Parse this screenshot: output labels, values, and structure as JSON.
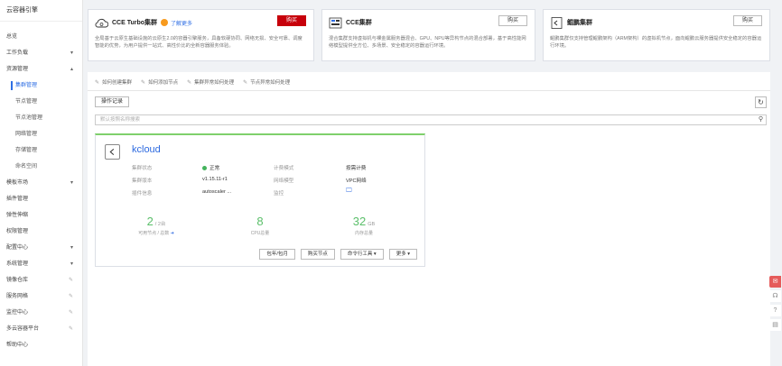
{
  "sidebar": {
    "brand": "云容器引擎",
    "items": [
      {
        "label": "总览",
        "sub": false
      },
      {
        "label": "工作负载",
        "sub": false,
        "caret": "▾"
      },
      {
        "label": "资源管理",
        "sub": false,
        "caret": "▴"
      },
      {
        "label": "集群管理",
        "sub": true,
        "active": true
      },
      {
        "label": "节点管理",
        "sub": true
      },
      {
        "label": "节点池管理",
        "sub": true
      },
      {
        "label": "网络管理",
        "sub": true
      },
      {
        "label": "存储管理",
        "sub": true
      },
      {
        "label": "命名空间",
        "sub": true
      },
      {
        "label": "模板市场",
        "sub": false,
        "caret": "▾"
      },
      {
        "label": "插件管理",
        "sub": false
      },
      {
        "label": "弹性伸缩",
        "sub": false
      },
      {
        "label": "权限管理",
        "sub": false
      },
      {
        "label": "配置中心",
        "sub": false,
        "caret": "▾"
      },
      {
        "label": "系统管理",
        "sub": false,
        "caret": "▾"
      },
      {
        "label": "镜像仓库",
        "sub": false,
        "pin": true
      },
      {
        "label": "服务网格",
        "sub": false,
        "pin": true
      },
      {
        "label": "监控中心",
        "sub": false,
        "pin": true
      },
      {
        "label": "多云容器平台",
        "sub": false,
        "pin": true
      },
      {
        "label": "帮助中心",
        "sub": false
      }
    ]
  },
  "cards": [
    {
      "title": "CCE Turbo集群",
      "link": "了解更多",
      "buy": "购买",
      "desc": "全局基于云原生基础设施的云原生2.0的容器引擎服务，具备软硬协同、网络无损、安全可靠、调度智能的优势，为用户提供一站式、高性价比的全新容器服务体验。"
    },
    {
      "title": "CCE集群",
      "buy": "购买",
      "desc": "混合集群支持虚拟机与裸金属服务器混合、GPU、NPU等异构节点的混合部署，基于高性能网络模型提供全方位、多场景、安全稳定的容器运行环境。"
    },
    {
      "title": "鲲鹏集群",
      "buy": "购买",
      "desc": "鲲鹏集群仅支持管理鲲鹏架构（ARM架构）的虚拟机节点，面向鲲鹏云服务器提供安全稳定的容器运行环境。"
    }
  ],
  "help_links": [
    "如何创建集群",
    "如何添加节点",
    "集群异常如何处理",
    "节点异常如何处理"
  ],
  "toolbar": {
    "ops_label": "操作记录",
    "refresh_icon": "refresh-icon"
  },
  "search": {
    "placeholder": "默认按照名称搜索",
    "value": ""
  },
  "cluster": {
    "name": "kcloud",
    "status_label": "集群状态",
    "status": "正常",
    "version_label": "集群版本",
    "version": "v1.15.11-r1",
    "plugins_label": "插件信息",
    "plugins": "autoscaler ...",
    "billing_label": "计费模式",
    "billing": "按需计费",
    "network_label": "网络模型",
    "network": "VPC网络",
    "monitor_label": "监控",
    "status_color": "#44b35d",
    "stats": [
      {
        "value": "2",
        "unit": "/ 2台",
        "label": "可用节点 / 总数"
      },
      {
        "value": "8",
        "unit": "",
        "label": "CPU总量"
      },
      {
        "value": "32",
        "unit": "GB",
        "label": "内存总量"
      }
    ],
    "actions": [
      {
        "label": "包年/包月"
      },
      {
        "label": "购买节点"
      },
      {
        "label": "命令行工具 ▾"
      },
      {
        "label": "更多 ▾"
      }
    ]
  }
}
